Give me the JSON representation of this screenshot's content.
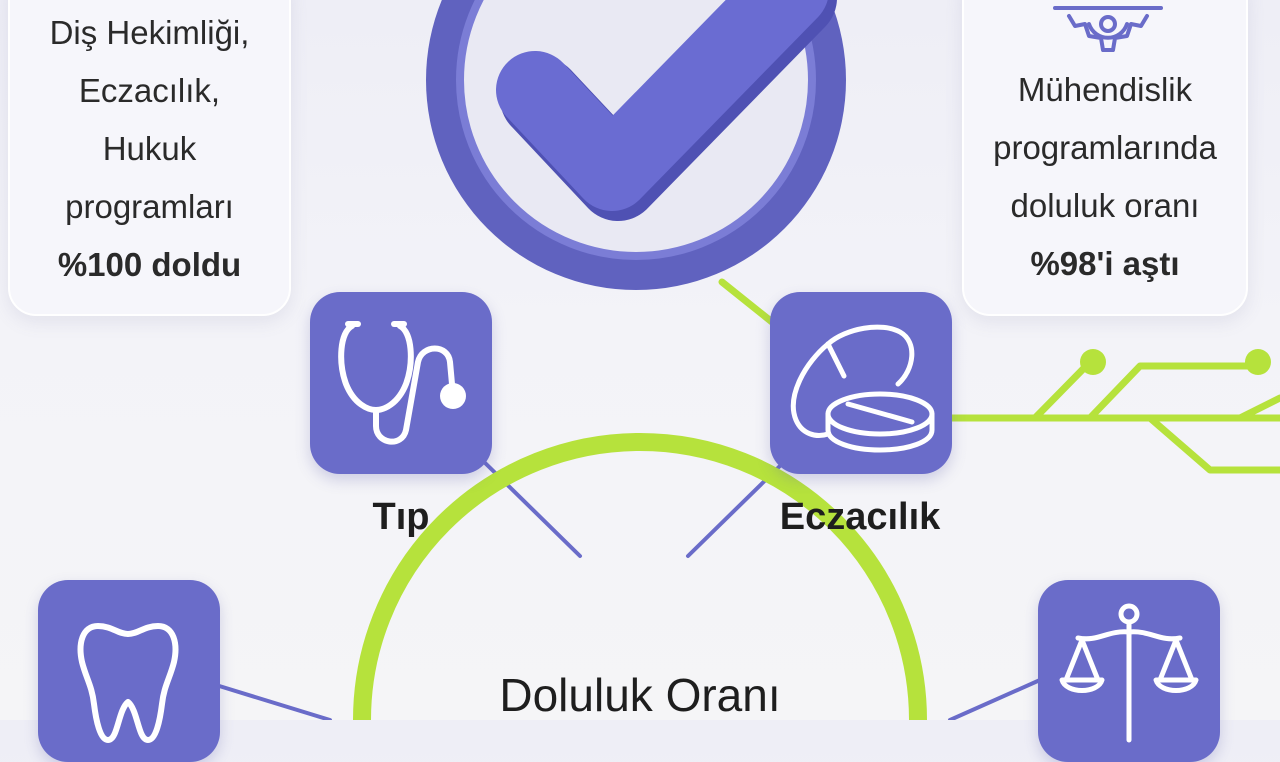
{
  "cards": {
    "left": {
      "lines": [
        "Diş Hekimliği,",
        "Eczacılık,",
        "Hukuk",
        "programları"
      ],
      "highlight": "%100 doldu"
    },
    "right": {
      "lines": [
        "Mühendislik",
        "programlarında",
        "doluluk oranı"
      ],
      "highlight": "%98'i aştı"
    }
  },
  "tiles": {
    "tip": {
      "label": "Tıp",
      "icon": "stethoscope-icon"
    },
    "eczacilik": {
      "label": "Eczacılık",
      "icon": "pills-icon"
    },
    "dis": {
      "icon": "tooth-icon"
    },
    "hukuk": {
      "icon": "scales-icon"
    }
  },
  "center": {
    "label": "Doluluk Oranı"
  },
  "colors": {
    "accent_purple": "#6a6cc9",
    "accent_green": "#b6e23c",
    "text": "#1e1e1e"
  }
}
